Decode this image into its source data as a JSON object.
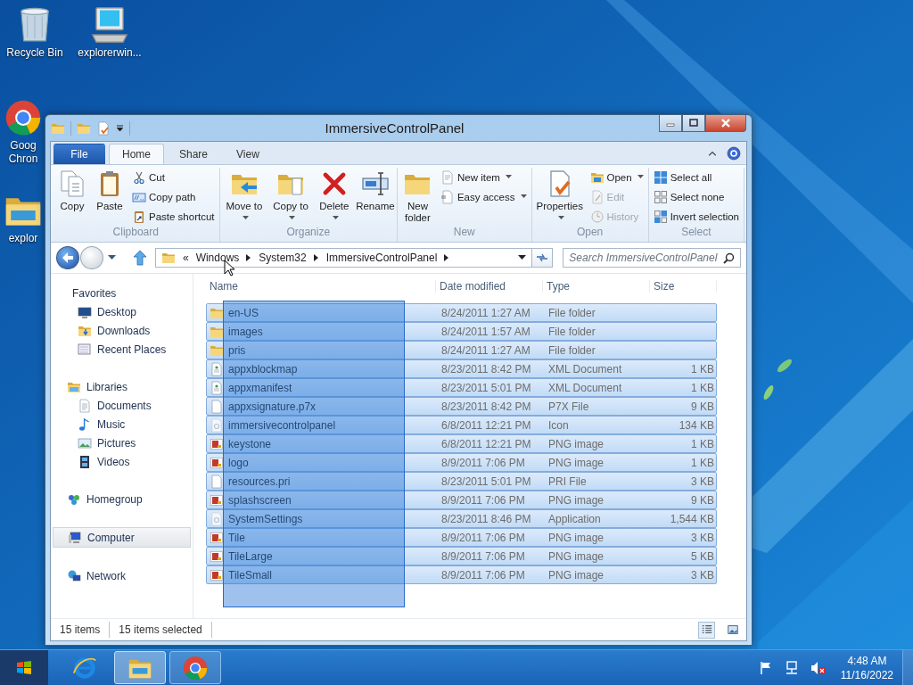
{
  "desktop_icons": [
    {
      "lines": [
        "Recycle Bin"
      ],
      "kind": "recycle"
    },
    {
      "lines": [
        "explorerwin..."
      ],
      "kind": "computer"
    },
    {
      "lines": [
        "Goog",
        "Chron"
      ],
      "kind": "chrome"
    },
    {
      "lines": [
        "explor"
      ],
      "kind": "explorer"
    }
  ],
  "window": {
    "title": "ImmersiveControlPanel"
  },
  "ribbon_tabs": [
    {
      "label": "File",
      "kind": "menu",
      "selected": false
    },
    {
      "label": "Home",
      "kind": "tab",
      "selected": true
    },
    {
      "label": "Share",
      "kind": "tab",
      "selected": false
    },
    {
      "label": "View",
      "kind": "tab",
      "selected": false
    }
  ],
  "ribbon_groups": [
    {
      "label": "Clipboard",
      "items": [
        {
          "label": "Copy",
          "kind": "large",
          "dropdown": false,
          "disabled": false
        },
        {
          "label": "Paste",
          "kind": "large",
          "dropdown": false,
          "disabled": false
        },
        {
          "label": "Cut",
          "kind": "small",
          "dropdown": false,
          "disabled": false
        },
        {
          "label": "Copy path",
          "kind": "small",
          "dropdown": false,
          "disabled": false
        },
        {
          "label": "Paste shortcut",
          "kind": "small",
          "dropdown": false,
          "disabled": false
        }
      ]
    },
    {
      "label": "Organize",
      "items": [
        {
          "label": "Move to",
          "kind": "large",
          "dropdown": true,
          "disabled": false
        },
        {
          "label": "Copy to",
          "kind": "large",
          "dropdown": true,
          "disabled": false
        },
        {
          "label": "Delete",
          "kind": "large",
          "dropdown": true,
          "disabled": false
        },
        {
          "label": "Rename",
          "kind": "large",
          "dropdown": false,
          "disabled": false
        }
      ]
    },
    {
      "label": "New",
      "items": [
        {
          "label": "New folder",
          "kind": "large",
          "dropdown": false,
          "disabled": false
        },
        {
          "label": "New item",
          "kind": "small",
          "dropdown": true,
          "disabled": false
        },
        {
          "label": "Easy access",
          "kind": "small",
          "dropdown": true,
          "disabled": false
        }
      ]
    },
    {
      "label": "Open",
      "items": [
        {
          "label": "Properties",
          "kind": "large",
          "dropdown": true,
          "disabled": false
        },
        {
          "label": "Open",
          "kind": "small",
          "dropdown": true,
          "disabled": false
        },
        {
          "label": "Edit",
          "kind": "small",
          "dropdown": false,
          "disabled": true
        },
        {
          "label": "History",
          "kind": "small",
          "dropdown": false,
          "disabled": true
        }
      ]
    },
    {
      "label": "Select",
      "items": [
        {
          "label": "Select all",
          "kind": "small",
          "dropdown": false,
          "disabled": false
        },
        {
          "label": "Select none",
          "kind": "small",
          "dropdown": false,
          "disabled": false
        },
        {
          "label": "Invert selection",
          "kind": "small",
          "dropdown": false,
          "disabled": false
        }
      ]
    }
  ],
  "address": {
    "overflow": "«",
    "segments": [
      "Windows",
      "System32",
      "ImmersiveControlPanel"
    ]
  },
  "search": {
    "placeholder": "Search ImmersiveControlPanel"
  },
  "navigation": [
    {
      "label": "Favorites",
      "kind": "favorites",
      "selected": false,
      "children": [
        {
          "label": "Desktop",
          "kind": "desktop",
          "selected": false
        },
        {
          "label": "Downloads",
          "kind": "downloads",
          "selected": false
        },
        {
          "label": "Recent Places",
          "kind": "recent",
          "selected": false
        }
      ]
    },
    {
      "label": "Libraries",
      "kind": "libraries",
      "selected": false,
      "children": [
        {
          "label": "Documents",
          "kind": "documents",
          "selected": false
        },
        {
          "label": "Music",
          "kind": "music",
          "selected": false
        },
        {
          "label": "Pictures",
          "kind": "pictures",
          "selected": false
        },
        {
          "label": "Videos",
          "kind": "videos",
          "selected": false
        }
      ]
    },
    {
      "label": "Homegroup",
      "kind": "homegroup",
      "selected": false
    },
    {
      "label": "Computer",
      "kind": "computer",
      "selected": true
    },
    {
      "label": "Network",
      "kind": "network",
      "selected": false
    }
  ],
  "columns": [
    "Name",
    "Date modified",
    "Type",
    "Size"
  ],
  "drag_selection": true,
  "files": [
    {
      "name": "en-US",
      "date": "8/24/2011 1:27 AM",
      "type": "File folder",
      "kind": "folder",
      "selected": true
    },
    {
      "name": "images",
      "date": "8/24/2011 1:57 AM",
      "type": "File folder",
      "kind": "folder",
      "selected": true
    },
    {
      "name": "pris",
      "date": "8/24/2011 1:27 AM",
      "type": "File folder",
      "kind": "folder",
      "selected": true
    },
    {
      "name": "appxblockmap",
      "date": "8/23/2011 8:42 PM",
      "type": "XML Document",
      "size": "1 KB",
      "kind": "xml",
      "selected": true
    },
    {
      "name": "appxmanifest",
      "date": "8/23/2011 5:01 PM",
      "type": "XML Document",
      "size": "1 KB",
      "kind": "xml",
      "selected": true
    },
    {
      "name": "appxsignature.p7x",
      "date": "8/23/2011 8:42 PM",
      "type": "P7X File",
      "size": "9 KB",
      "kind": "file",
      "selected": true
    },
    {
      "name": "immersivecontrolpanel",
      "date": "6/8/2011 12:21 PM",
      "type": "Icon",
      "size": "134 KB",
      "kind": "app",
      "selected": true
    },
    {
      "name": "keystone",
      "date": "6/8/2011 12:21 PM",
      "type": "PNG image",
      "size": "1 KB",
      "kind": "png",
      "selected": true
    },
    {
      "name": "logo",
      "date": "8/9/2011 7:06 PM",
      "type": "PNG image",
      "size": "1 KB",
      "kind": "png",
      "selected": true
    },
    {
      "name": "resources.pri",
      "date": "8/23/2011 5:01 PM",
      "type": "PRI File",
      "size": "3 KB",
      "kind": "file",
      "selected": true
    },
    {
      "name": "splashscreen",
      "date": "8/9/2011 7:06 PM",
      "type": "PNG image",
      "size": "9 KB",
      "kind": "png",
      "selected": true
    },
    {
      "name": "SystemSettings",
      "date": "8/23/2011 8:46 PM",
      "type": "Application",
      "size": "1,544 KB",
      "kind": "app",
      "selected": true
    },
    {
      "name": "Tile",
      "date": "8/9/2011 7:06 PM",
      "type": "PNG image",
      "size": "3 KB",
      "kind": "png",
      "selected": true
    },
    {
      "name": "TileLarge",
      "date": "8/9/2011 7:06 PM",
      "type": "PNG image",
      "size": "5 KB",
      "kind": "png",
      "selected": true
    },
    {
      "name": "TileSmall",
      "date": "8/9/2011 7:06 PM",
      "type": "PNG image",
      "size": "3 KB",
      "kind": "png",
      "selected": true
    }
  ],
  "status_bar": {
    "count": "15 items",
    "selection": "15 items selected"
  },
  "view_buttons": [
    {
      "kind": "details",
      "selected": true
    },
    {
      "kind": "large",
      "selected": false
    }
  ],
  "taskbar": {
    "apps": [
      {
        "kind": "ie",
        "running": false,
        "active": false
      },
      {
        "kind": "explorer",
        "running": true,
        "active": true
      },
      {
        "kind": "chrome",
        "running": true,
        "active": false
      }
    ],
    "volume": {
      "muted": true
    },
    "time": "4:48 AM",
    "date": "11/16/2022"
  }
}
